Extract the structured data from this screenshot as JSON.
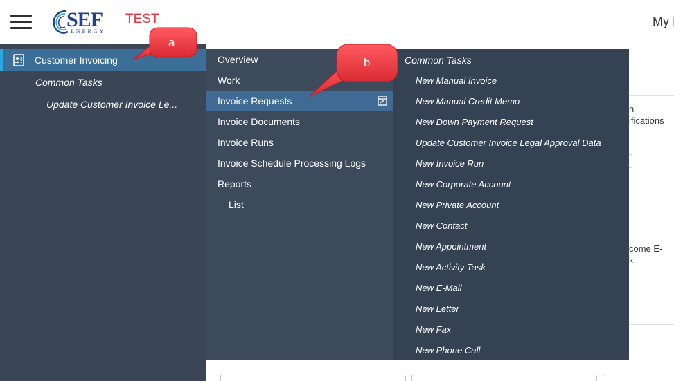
{
  "header": {
    "logo_text": "SEF",
    "logo_subtext": "ENERGY",
    "environment_label": "TEST",
    "user_menu_label": "My I"
  },
  "colors": {
    "nav_bg": "#3a4656",
    "nav_selected": "#3c6f98",
    "nav_accent": "#2aa7e0",
    "flyout_bg": "#3d4a5b",
    "flyout2_bg": "#354253",
    "callout_red": "#e8373f",
    "env_red": "#e8373f"
  },
  "leftnav": {
    "workcenter": {
      "label": "Customer Invoicing",
      "icon": "customer-invoicing-icon"
    },
    "common_tasks_label": "Common Tasks",
    "recent_item_label": "Update Customer Invoice Le..."
  },
  "flyout": {
    "items": [
      {
        "label": "Overview"
      },
      {
        "label": "Work"
      },
      {
        "label": "Invoice Requests",
        "active": true
      },
      {
        "label": "Invoice Documents"
      },
      {
        "label": "Invoice Runs"
      },
      {
        "label": "Invoice Schedule Processing Logs"
      },
      {
        "label": "Reports"
      },
      {
        "label": "List",
        "sub": true
      }
    ]
  },
  "common_tasks": {
    "header": "Common Tasks",
    "items": [
      "New Manual Invoice",
      "New Manual Credit Memo",
      "New Down Payment Request",
      "Update Customer Invoice Legal Approval Data",
      "New Invoice Run",
      "New Corporate Account",
      "New Private Account",
      "New Contact",
      "New Appointment",
      "New Activity Task",
      "New E-Mail",
      "New Letter",
      "New Fax",
      "New Phone Call"
    ]
  },
  "background": {
    "fragment1": "n",
    "fragment2": "ifications",
    "fragment3": "come E-",
    "fragment4": "k"
  },
  "callouts": {
    "a": "a",
    "b": "b"
  }
}
